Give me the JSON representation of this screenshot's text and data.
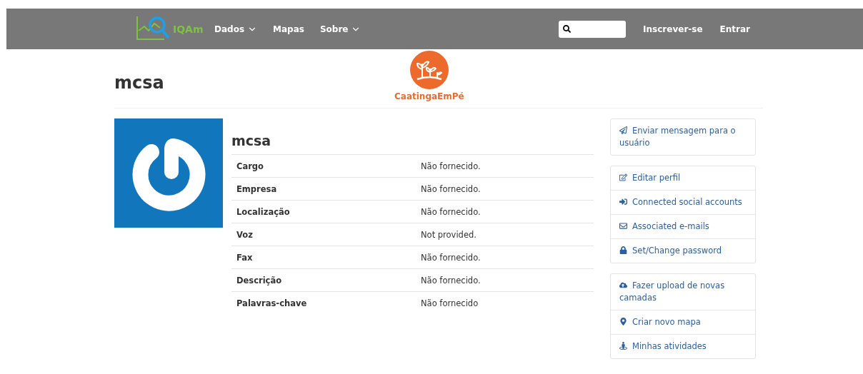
{
  "navbar": {
    "logo_text": "IQAm",
    "menu": [
      {
        "label": "Dados",
        "dropdown": true
      },
      {
        "label": "Mapas",
        "dropdown": false
      },
      {
        "label": "Sobre",
        "dropdown": true
      }
    ],
    "links": [
      "Inscrever-se",
      "Entrar"
    ]
  },
  "page_title": "mcsa",
  "partner_logo": {
    "text": "CaatingaEmPé"
  },
  "profile": {
    "name": "mcsa",
    "fields": [
      {
        "label": "Cargo",
        "value": "Não fornecido."
      },
      {
        "label": "Empresa",
        "value": "Não fornecido."
      },
      {
        "label": "Localização",
        "value": "Não fornecido."
      },
      {
        "label": "Voz",
        "value": "Not provided."
      },
      {
        "label": "Fax",
        "value": "Não fornecido."
      },
      {
        "label": "Descrição",
        "value": "Não fornecido."
      },
      {
        "label": "Palavras-chave",
        "value": "Não fornecido"
      }
    ]
  },
  "action_groups": [
    [
      "Enviar mensagem para o usuário"
    ],
    [
      "Editar perfil",
      "Connected social accounts",
      "Associated e-mails",
      "Set/Change password"
    ],
    [
      "Fazer upload de novas camadas",
      "Criar novo mapa",
      "Minhas atividades"
    ]
  ]
}
